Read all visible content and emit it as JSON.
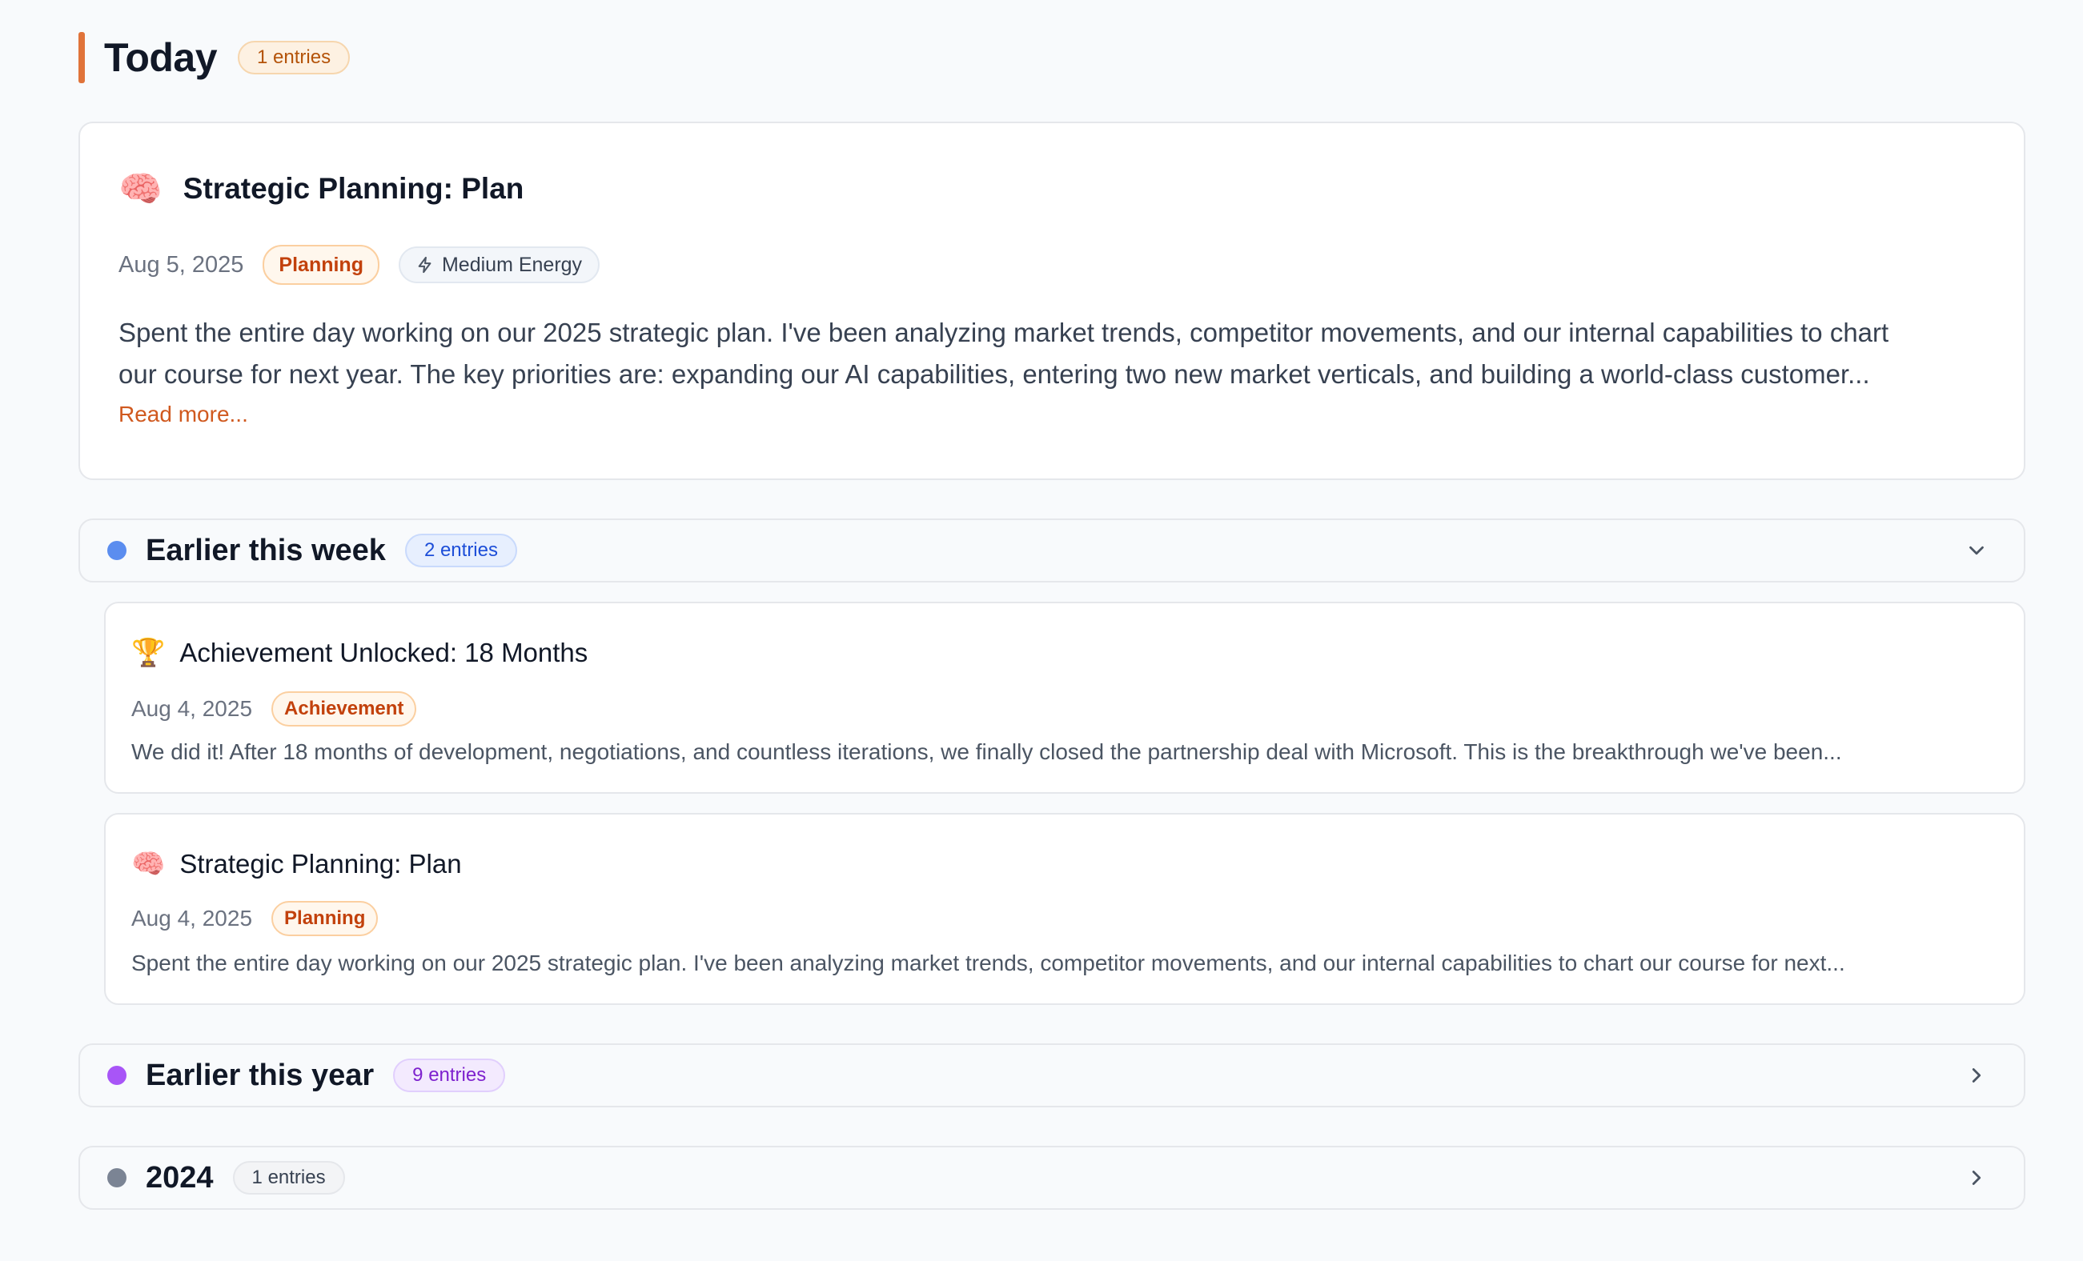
{
  "today": {
    "title": "Today",
    "count": "1 entries",
    "entry": {
      "icon": "🧠",
      "title": "Strategic Planning: Plan",
      "date": "Aug 5, 2025",
      "category": "Planning",
      "energy": "Medium Energy",
      "excerpt_line1": "Spent the entire day working on our 2025 strategic plan. I've been analyzing market trends, competitor movements, and our internal capabilities to chart",
      "excerpt_line2": "our course for next year. The key priorities are: expanding our AI capabilities, entering two new market verticals, and building a world-class customer...",
      "read_more": "Read more..."
    }
  },
  "sections": {
    "this_week": {
      "title": "Earlier this week",
      "count": "2 entries",
      "color": "#5b8def",
      "expanded": true,
      "entries": [
        {
          "icon": "🏆",
          "title": "Achievement Unlocked: 18 Months",
          "date": "Aug 4, 2025",
          "category": "Achievement",
          "excerpt": "We did it! After 18 months of development, negotiations, and countless iterations, we finally closed the partnership deal with Microsoft. This is the breakthrough we've been..."
        },
        {
          "icon": "🧠",
          "title": "Strategic Planning: Plan",
          "date": "Aug 4, 2025",
          "category": "Planning",
          "excerpt": "Spent the entire day working on our 2025 strategic plan. I've been analyzing market trends, competitor movements, and our internal capabilities to chart our course for next..."
        }
      ]
    },
    "this_year": {
      "title": "Earlier this year",
      "count": "9 entries",
      "color": "#a855f7",
      "expanded": false
    },
    "y2024": {
      "title": "2024",
      "count": "1 entries",
      "color": "#7b8494",
      "expanded": false
    }
  },
  "colors": {
    "accent": "#e0733a",
    "link": "#d0591f"
  }
}
